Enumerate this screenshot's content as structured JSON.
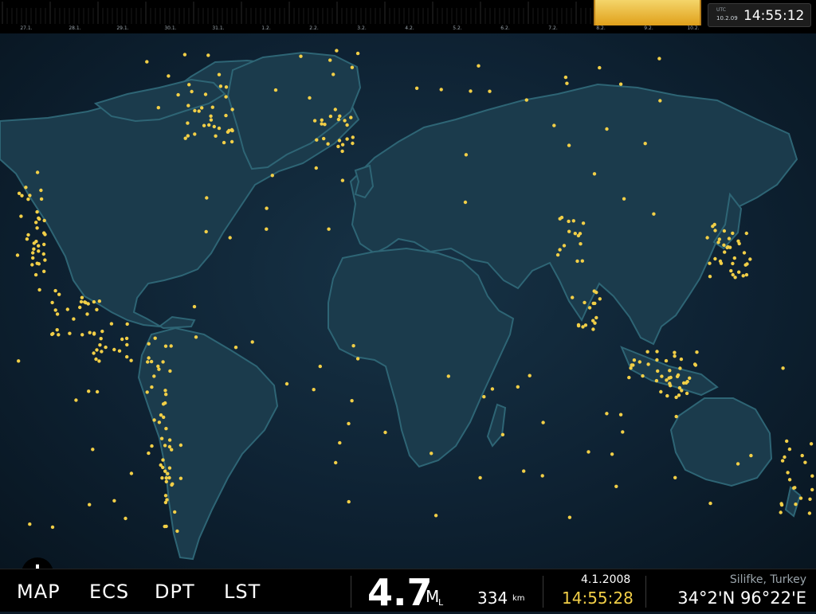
{
  "timeline": {
    "labels": [
      "27.1.",
      "28.1.",
      "29.1.",
      "30.1.",
      "31.1.",
      "1.2.",
      "2.2.",
      "3.2.",
      "4.2.",
      "5.2.",
      "6.2.",
      "7.2.",
      "8.2.",
      "9.2.",
      "10.2."
    ],
    "highlight_color": "#e9b630"
  },
  "utc_clock": {
    "label": "UTC",
    "date": "10.2.09",
    "time": "14:55:12"
  },
  "map": {
    "marker_color": "#f2cf47",
    "zoom_label": "+"
  },
  "nav": {
    "tabs": [
      "MAP",
      "ECS",
      "DPT",
      "LST"
    ]
  },
  "event": {
    "magnitude": "4.7",
    "magnitude_unit": "M",
    "magnitude_unit_sub": "L",
    "depth": "334",
    "depth_unit": "km",
    "date": "4.1.2008",
    "time": "14:55:28",
    "location": "Silifke, Turkey",
    "coordinates": "34°2'N 96°22'E"
  }
}
